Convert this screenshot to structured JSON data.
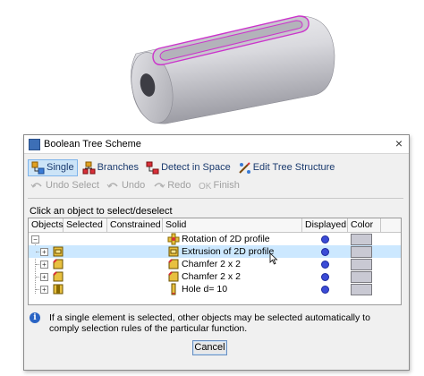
{
  "dialog": {
    "title": "Boolean Tree Scheme",
    "close_glyph": "×"
  },
  "toolbar1": [
    {
      "label": "Single",
      "icon": "single-select-icon",
      "active": true
    },
    {
      "label": "Branches",
      "icon": "branches-icon"
    },
    {
      "label": "Detect in Space",
      "icon": "detect-in-space-icon"
    },
    {
      "label": "Edit Tree Structure",
      "icon": "edit-tree-structure-icon"
    }
  ],
  "toolbar2": [
    {
      "label": "Undo Select",
      "icon": "undo-select-icon"
    },
    {
      "label": "Undo",
      "icon": "undo-icon"
    },
    {
      "label": "Redo",
      "icon": "redo-icon"
    },
    {
      "label": "Finish",
      "icon": "finish-icon"
    }
  ],
  "hint": "Click an object to select/deselect",
  "columns": [
    "Objects",
    "Selected",
    "Constrained",
    "Solid",
    "Displayed",
    "Color"
  ],
  "rows": [
    {
      "solid": "Rotation of 2D profile",
      "icon": "rotation-feature-icon",
      "selected": false
    },
    {
      "solid": "Extrusion of 2D profile",
      "icon": "extrusion-feature-icon",
      "selected": true
    },
    {
      "solid": "Chamfer 2 x 2",
      "icon": "chamfer-feature-icon",
      "selected": false
    },
    {
      "solid": "Chamfer 2 x 2",
      "icon": "chamfer-feature-icon",
      "selected": false
    },
    {
      "solid": "Hole d= 10",
      "icon": "hole-feature-icon",
      "selected": false
    }
  ],
  "info": "If a single element is selected, other objects may be selected automatically to comply selection rules of the particular function.",
  "buttons": {
    "cancel": "Cancel"
  },
  "colors": {
    "highlight": "#cc33cc",
    "dot": "#3b4bd6",
    "swatch": "#c9c9d3",
    "selected_row": "#cce8ff"
  }
}
